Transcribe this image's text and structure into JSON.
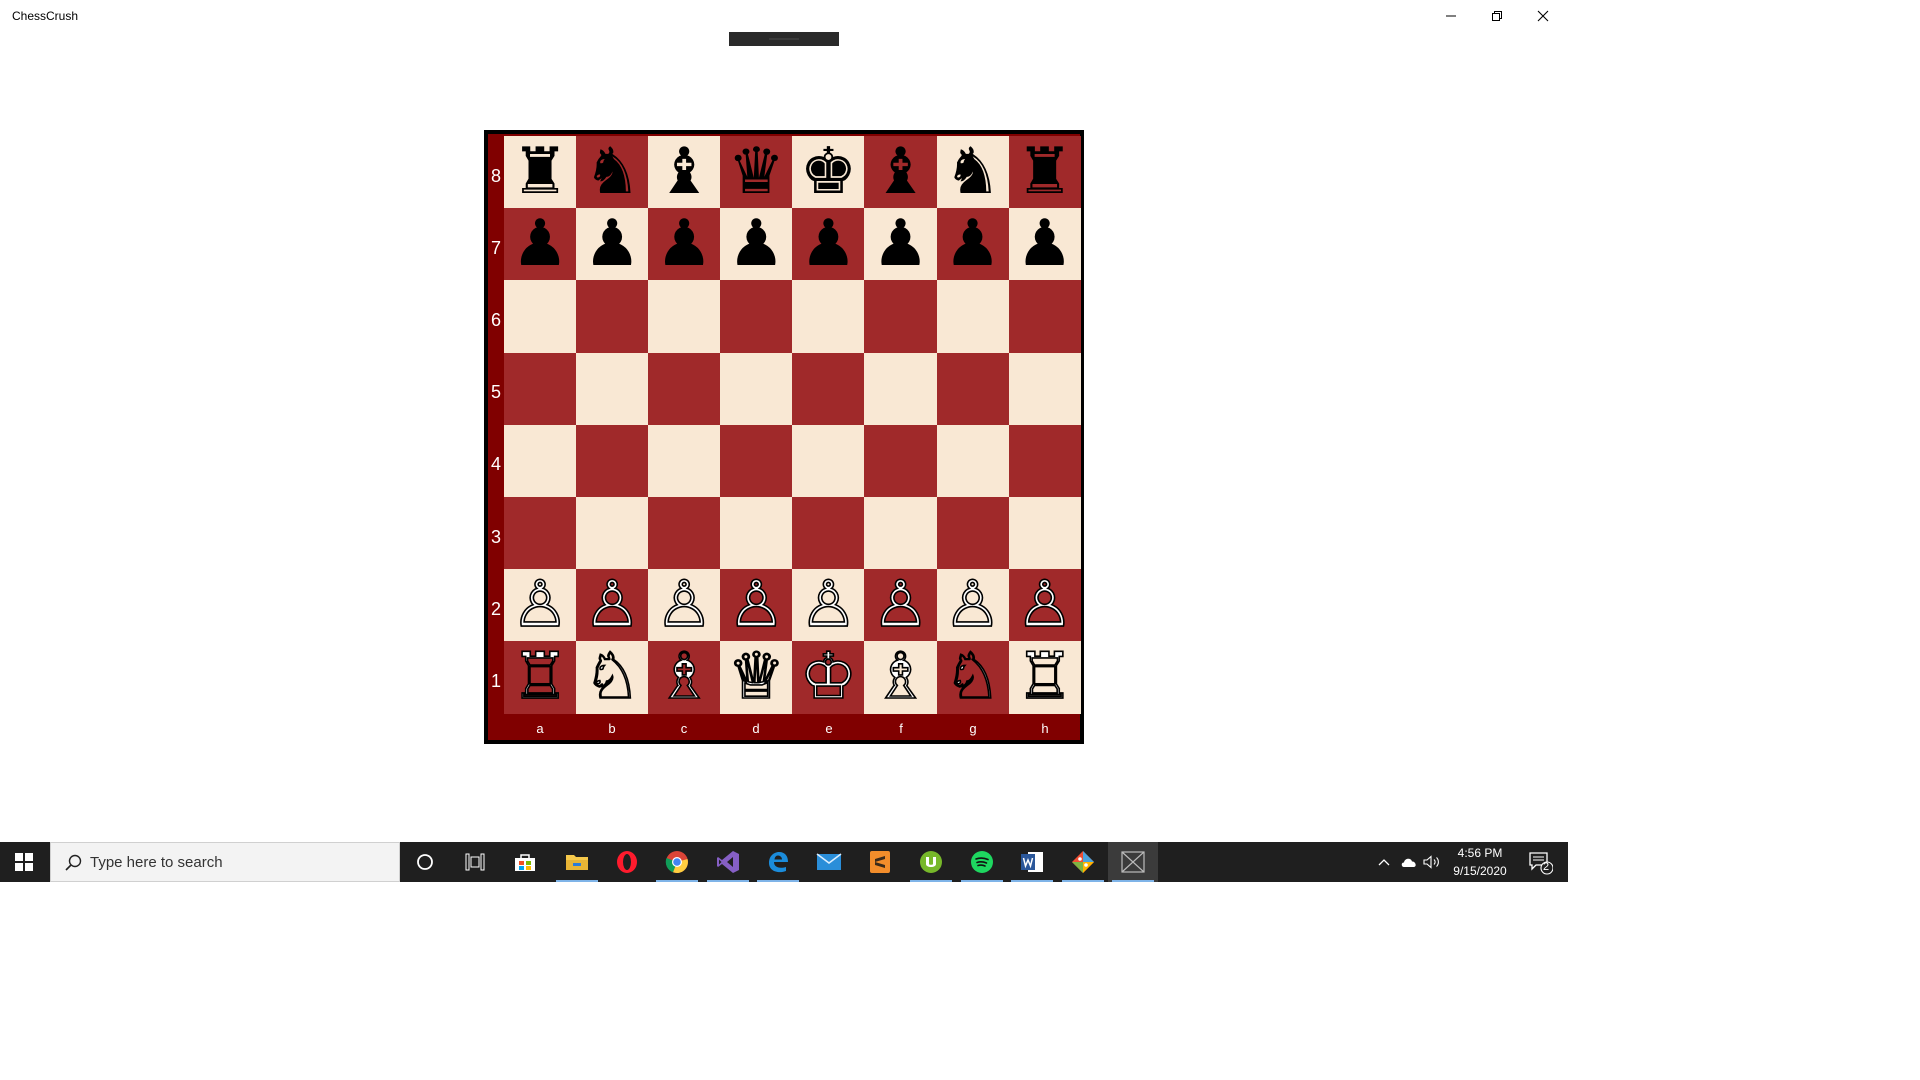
{
  "app": {
    "title": "ChessCrush"
  },
  "colors": {
    "light_square": "#f9e8d4",
    "dark_square": "#a0292a",
    "border": "#800000"
  },
  "board": {
    "ranks": [
      "8",
      "7",
      "6",
      "5",
      "4",
      "3",
      "2",
      "1"
    ],
    "files": [
      "a",
      "b",
      "c",
      "d",
      "e",
      "f",
      "g",
      "h"
    ],
    "position": [
      [
        "♜",
        "♞",
        "♝",
        "♛",
        "♚",
        "♝",
        "♞",
        "♜"
      ],
      [
        "♟",
        "♟",
        "♟",
        "♟",
        "♟",
        "♟",
        "♟",
        "♟"
      ],
      [
        "",
        "",
        "",
        "",
        "",
        "",
        "",
        ""
      ],
      [
        "",
        "",
        "",
        "",
        "",
        "",
        "",
        ""
      ],
      [
        "",
        "",
        "",
        "",
        "",
        "",
        "",
        ""
      ],
      [
        "",
        "",
        "",
        "",
        "",
        "",
        "",
        ""
      ],
      [
        "♙",
        "♙",
        "♙",
        "♙",
        "♙",
        "♙",
        "♙",
        "♙"
      ],
      [
        "♖",
        "♘",
        "♗",
        "♕",
        "♔",
        "♗",
        "♘",
        "♖"
      ]
    ]
  },
  "taskbar": {
    "search_placeholder": "Type here to search",
    "time": "4:56 PM",
    "date": "9/15/2020",
    "notification_count": "2",
    "apps": [
      "cortana-icon",
      "task-view-icon",
      "store-icon",
      "file-explorer-icon",
      "opera-icon",
      "chrome-icon",
      "visual-studio-icon",
      "edge-icon",
      "mail-icon",
      "sublime-text-icon",
      "utorrent-icon",
      "spotify-icon",
      "word-icon",
      "git-icon",
      "chesscrush-icon"
    ]
  }
}
